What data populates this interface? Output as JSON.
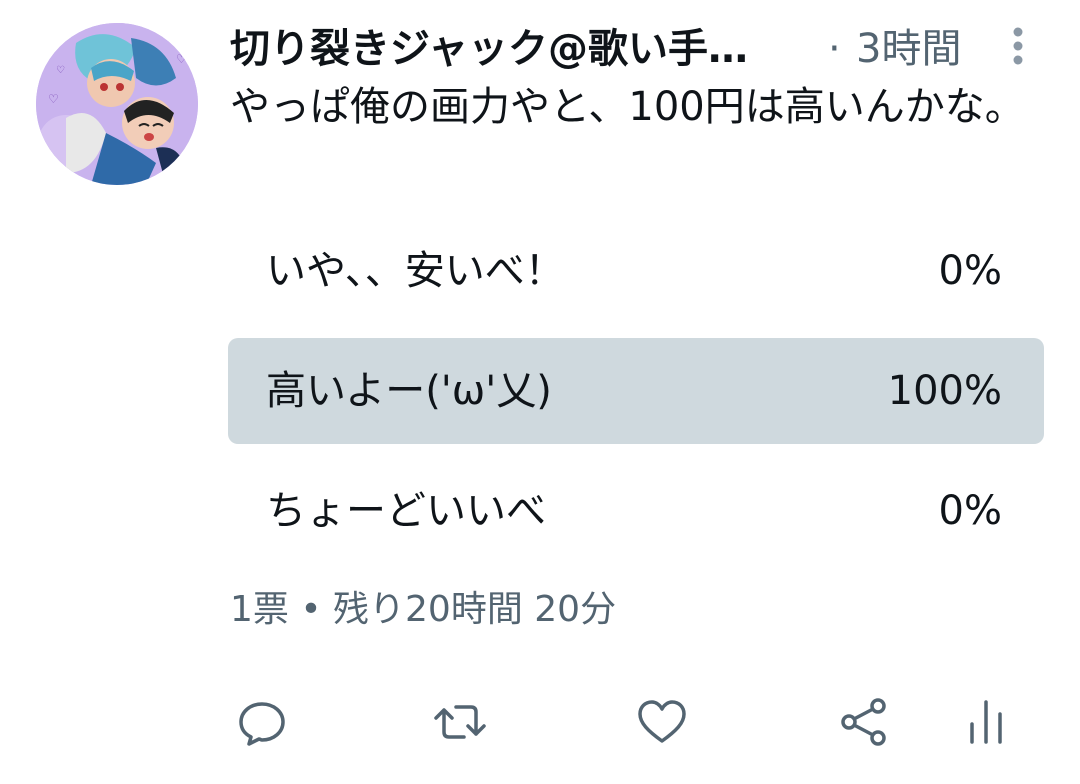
{
  "tweet": {
    "display_name": "切り裂きジャック@歌い手…",
    "separator": "·",
    "timestamp": "3時間",
    "text": "やっぱ俺の画力やと、100円は高いんかな。"
  },
  "poll": {
    "options": [
      {
        "label": "いや、、安いべ！",
        "percent": "0%",
        "share": 0
      },
      {
        "label": "高いよー('ω'乂)",
        "percent": "100%",
        "share": 1.0
      },
      {
        "label": "ちょーどいいべ",
        "percent": "0%",
        "share": 0
      }
    ],
    "status": "1票 • 残り20時間 20分"
  },
  "icons": {
    "more": "more-vertical-icon",
    "reply": "reply-icon",
    "retweet": "retweet-icon",
    "like": "heart-icon",
    "share": "share-icon",
    "analytics": "analytics-icon"
  },
  "colors": {
    "text_primary": "#0f1419",
    "text_secondary": "#536471",
    "poll_bar": "#cfd9de",
    "avatar_bg": "#c9b3ee"
  }
}
